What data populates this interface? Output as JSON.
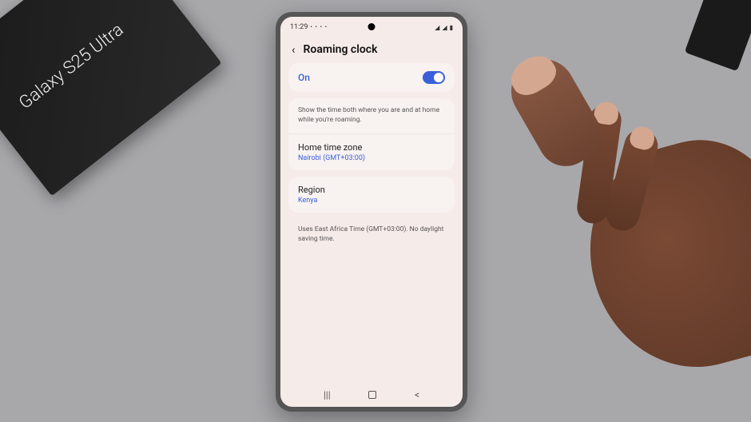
{
  "product_box": {
    "label": "Galaxy S25 Ultra"
  },
  "status": {
    "time": "11:29",
    "icons": "⚡ 📶 📶 🔋"
  },
  "header": {
    "title": "Roaming clock"
  },
  "toggle": {
    "label": "On",
    "state": true
  },
  "description": "Show the time both where you are and at home while you're roaming.",
  "home_timezone": {
    "label": "Home time zone",
    "value": "Nairobi (GMT+03:00)"
  },
  "region": {
    "label": "Region",
    "value": "Kenya"
  },
  "footer_note": "Uses East Africa Time (GMT+03:00). No daylight saving time.",
  "nav": {
    "recents": "|||",
    "back": "<"
  }
}
